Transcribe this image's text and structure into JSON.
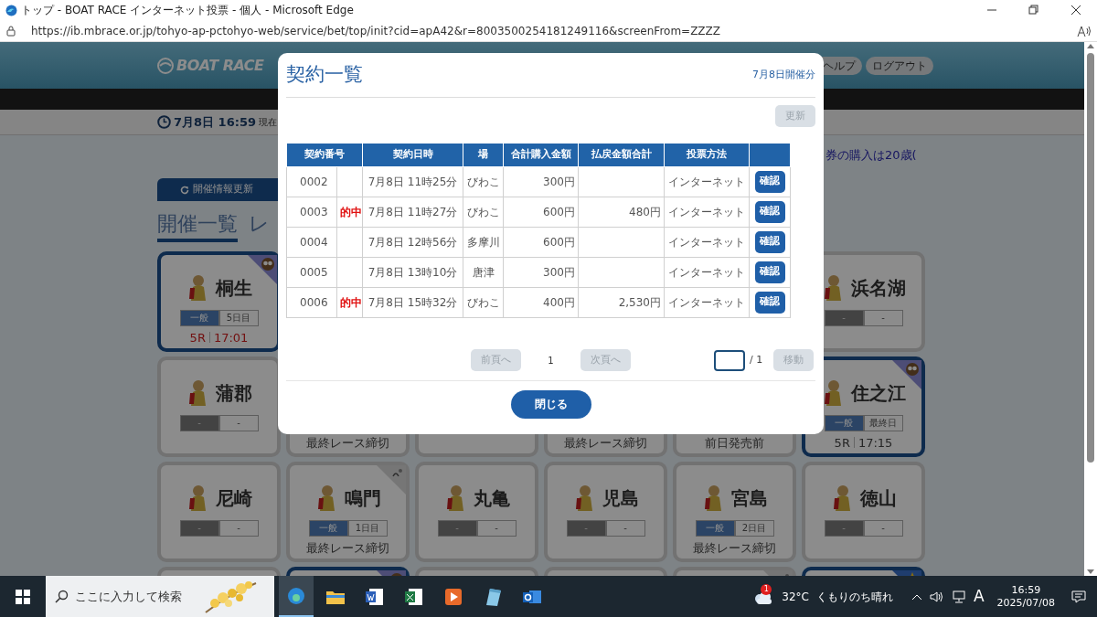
{
  "browser": {
    "title": "トップ - BOAT RACE インターネット投票 - 個人 - Microsoft Edge",
    "url": "https://ib.mbrace.or.jp/tohyo-ap-pctohyo-web/service/bet/top/init?cid=apA42&r=8003500254181249116&screenFrom=ZZZZ"
  },
  "header": {
    "logo": "BOAT RACE",
    "help": "ヘルプ",
    "logout": "ログアウト"
  },
  "date_bar": {
    "datetime": "7月8日 16:59",
    "suffix": "現在"
  },
  "notice": "券の購入は20歳(",
  "refresh_button": "開催情報更新",
  "tabs": [
    {
      "label": "開催一覧",
      "selected": true
    },
    {
      "label": "レ",
      "selected": false
    }
  ],
  "venues": [
    {
      "kind": "card",
      "name": "桐生",
      "active": true,
      "corner": {
        "kind": "owl"
      },
      "grade": "一般",
      "grade_open": true,
      "day": "5日目",
      "race": "5R",
      "time": "17:01",
      "urgent": true
    },
    {
      "kind": "covered"
    },
    {
      "kind": "covered"
    },
    {
      "kind": "covered"
    },
    {
      "kind": "covered"
    },
    {
      "kind": "card",
      "name": "浜名湖",
      "active": false,
      "grade": "-",
      "grade_open": false,
      "day": "-"
    },
    {
      "kind": "card",
      "name": "蒲郡",
      "active": false,
      "grade": "-",
      "grade_open": false,
      "day": "-"
    },
    {
      "kind": "card",
      "active": false,
      "status": "最終レース締切"
    },
    {
      "kind": "card",
      "active": false
    },
    {
      "kind": "card",
      "active": false,
      "status": "最終レース締切"
    },
    {
      "kind": "card",
      "active": false,
      "status": "前日発売前"
    },
    {
      "kind": "card",
      "name": "住之江",
      "active": true,
      "corner": {
        "kind": "owl"
      },
      "grade": "一般",
      "grade_open": true,
      "day": "最終日",
      "race": "5R",
      "time": "17:15",
      "urgent": false
    },
    {
      "kind": "card",
      "name": "尼崎",
      "active": false,
      "grade": "-",
      "grade_open": false,
      "day": "-"
    },
    {
      "kind": "card",
      "name": "鳴門",
      "active": false,
      "corner": {
        "kind": "mark"
      },
      "grade": "一般",
      "grade_open": true,
      "day": "1日目",
      "status": "最終レース締切"
    },
    {
      "kind": "card",
      "name": "丸亀",
      "active": false,
      "grade": "-",
      "grade_open": false,
      "day": "-"
    },
    {
      "kind": "card",
      "name": "児島",
      "active": false,
      "grade": "-",
      "grade_open": false,
      "day": "-"
    },
    {
      "kind": "card",
      "name": "宮島",
      "active": false,
      "grade": "一般",
      "grade_open": true,
      "day": "2日目",
      "status": "最終レース締切"
    },
    {
      "kind": "card",
      "name": "徳山",
      "active": false,
      "grade": "-",
      "grade_open": false,
      "day": "-"
    },
    {
      "kind": "card",
      "active": false
    },
    {
      "kind": "card",
      "active": true,
      "corner": {
        "kind": "owl"
      }
    },
    {
      "kind": "card",
      "active": false
    },
    {
      "kind": "card",
      "active": false
    },
    {
      "kind": "card",
      "active": false,
      "corner": {
        "kind": "mark"
      }
    },
    {
      "kind": "card",
      "active": true,
      "corner": {
        "kind": "star"
      }
    }
  ],
  "modal": {
    "title": "契約一覧",
    "date_label": "7月8日開催分",
    "refresh": {
      "label": "更新",
      "disabled": true
    },
    "columns": [
      "契約番号",
      "契約日時",
      "場",
      "合計購入金額",
      "払戻金額合計",
      "投票方法"
    ],
    "rows": [
      {
        "number": "0002",
        "datetime": "7月8日 11時25分",
        "venue": "びわこ",
        "purchase": "300円",
        "method": "インターネット",
        "action": "確認"
      },
      {
        "number": "0003",
        "hit": "的中",
        "datetime": "7月8日 11時27分",
        "venue": "びわこ",
        "purchase": "600円",
        "payout": "480円",
        "method": "インターネット",
        "action": "確認"
      },
      {
        "number": "0004",
        "datetime": "7月8日 12時56分",
        "venue": "多摩川",
        "purchase": "600円",
        "method": "インターネット",
        "action": "確認"
      },
      {
        "number": "0005",
        "datetime": "7月8日 13時10分",
        "venue": "唐津",
        "purchase": "300円",
        "method": "インターネット",
        "action": "確認"
      },
      {
        "number": "0006",
        "hit": "的中",
        "datetime": "7月8日 15時32分",
        "venue": "びわこ",
        "purchase": "400円",
        "payout": "2,530円",
        "method": "インターネット",
        "action": "確認"
      }
    ],
    "pager": {
      "prev": {
        "label": "前頁へ",
        "disabled": true
      },
      "page": "1",
      "next": {
        "label": "次頁へ",
        "disabled": true
      },
      "total": "/ 1",
      "go": {
        "label": "移動",
        "disabled": true
      }
    },
    "close": "閉じる"
  },
  "taskbar": {
    "search_placeholder": "ここに入力して検索",
    "apps": [
      {
        "kind": "browser",
        "selected": true
      },
      {
        "kind": "folder",
        "selected": false
      },
      {
        "kind": "word",
        "selected": false
      },
      {
        "kind": "excel",
        "selected": false
      },
      {
        "kind": "media",
        "selected": false
      },
      {
        "kind": "notepad",
        "selected": false
      },
      {
        "kind": "mail",
        "selected": false
      }
    ],
    "weather": {
      "badge": "1",
      "temperature": "32°C",
      "condition": "くもりのち晴れ"
    },
    "ime": "A",
    "time": "16:59",
    "date": "2025/07/08"
  }
}
